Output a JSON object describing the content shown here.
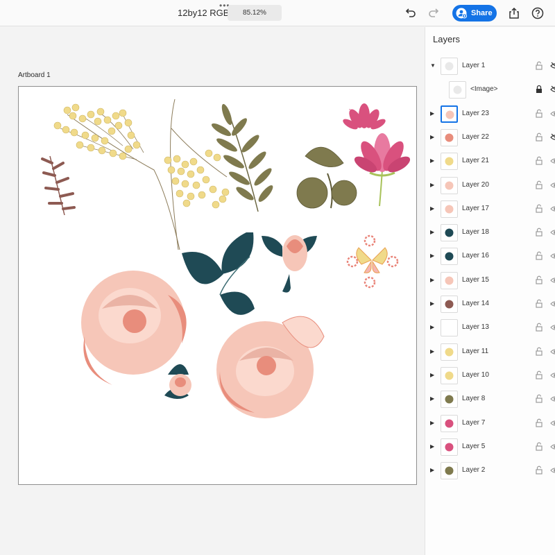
{
  "header": {
    "doc_title": "12by12 RGB",
    "more_dots": "•••",
    "zoom": "85.12%",
    "share_label": "Share",
    "icons": [
      "undo-icon",
      "redo-icon",
      "share-user-icon",
      "export-icon",
      "help-icon"
    ]
  },
  "canvas": {
    "artboard_label": "Artboard 1"
  },
  "layers_panel": {
    "title": "Layers",
    "rows": [
      {
        "name": "Layer 1",
        "expanded": true,
        "lock": "unlocked",
        "eye": "hidden"
      },
      {
        "name": "<Image>",
        "child": true,
        "lock": "locked",
        "eye": "hidden"
      },
      {
        "name": "Layer 23",
        "selected": true,
        "lock": "unlocked",
        "eye": "visible"
      },
      {
        "name": "Layer 22",
        "lock": "unlocked",
        "eye": "hidden"
      },
      {
        "name": "Layer 21",
        "lock": "unlocked",
        "eye": "visible"
      },
      {
        "name": "Layer 20",
        "lock": "unlocked",
        "eye": "visible"
      },
      {
        "name": "Layer 17",
        "lock": "unlocked",
        "eye": "visible"
      },
      {
        "name": "Layer 18",
        "lock": "unlocked",
        "eye": "visible"
      },
      {
        "name": "Layer 16",
        "lock": "unlocked",
        "eye": "visible"
      },
      {
        "name": "Layer 15",
        "lock": "unlocked",
        "eye": "visible"
      },
      {
        "name": "Layer 14",
        "lock": "unlocked",
        "eye": "visible"
      },
      {
        "name": "Layer 13",
        "lock": "unlocked",
        "eye": "visible"
      },
      {
        "name": "Layer 11",
        "lock": "unlocked",
        "eye": "visible"
      },
      {
        "name": "Layer 10",
        "lock": "unlocked",
        "eye": "visible"
      },
      {
        "name": "Layer 8",
        "lock": "unlocked",
        "eye": "visible"
      },
      {
        "name": "Layer 7",
        "lock": "unlocked",
        "eye": "visible"
      },
      {
        "name": "Layer 5",
        "lock": "unlocked",
        "eye": "visible"
      },
      {
        "name": "Layer 2",
        "lock": "unlocked",
        "eye": "visible"
      }
    ]
  },
  "colors": {
    "accent": "#1473e6",
    "rose": "#f6c6b8",
    "rose_dark": "#e88d7c",
    "leaf_teal": "#1f4a55",
    "olive": "#7f7a4e",
    "mimosa": "#f0da8a",
    "lotus": "#d9517e",
    "fern": "#8d5a52"
  }
}
